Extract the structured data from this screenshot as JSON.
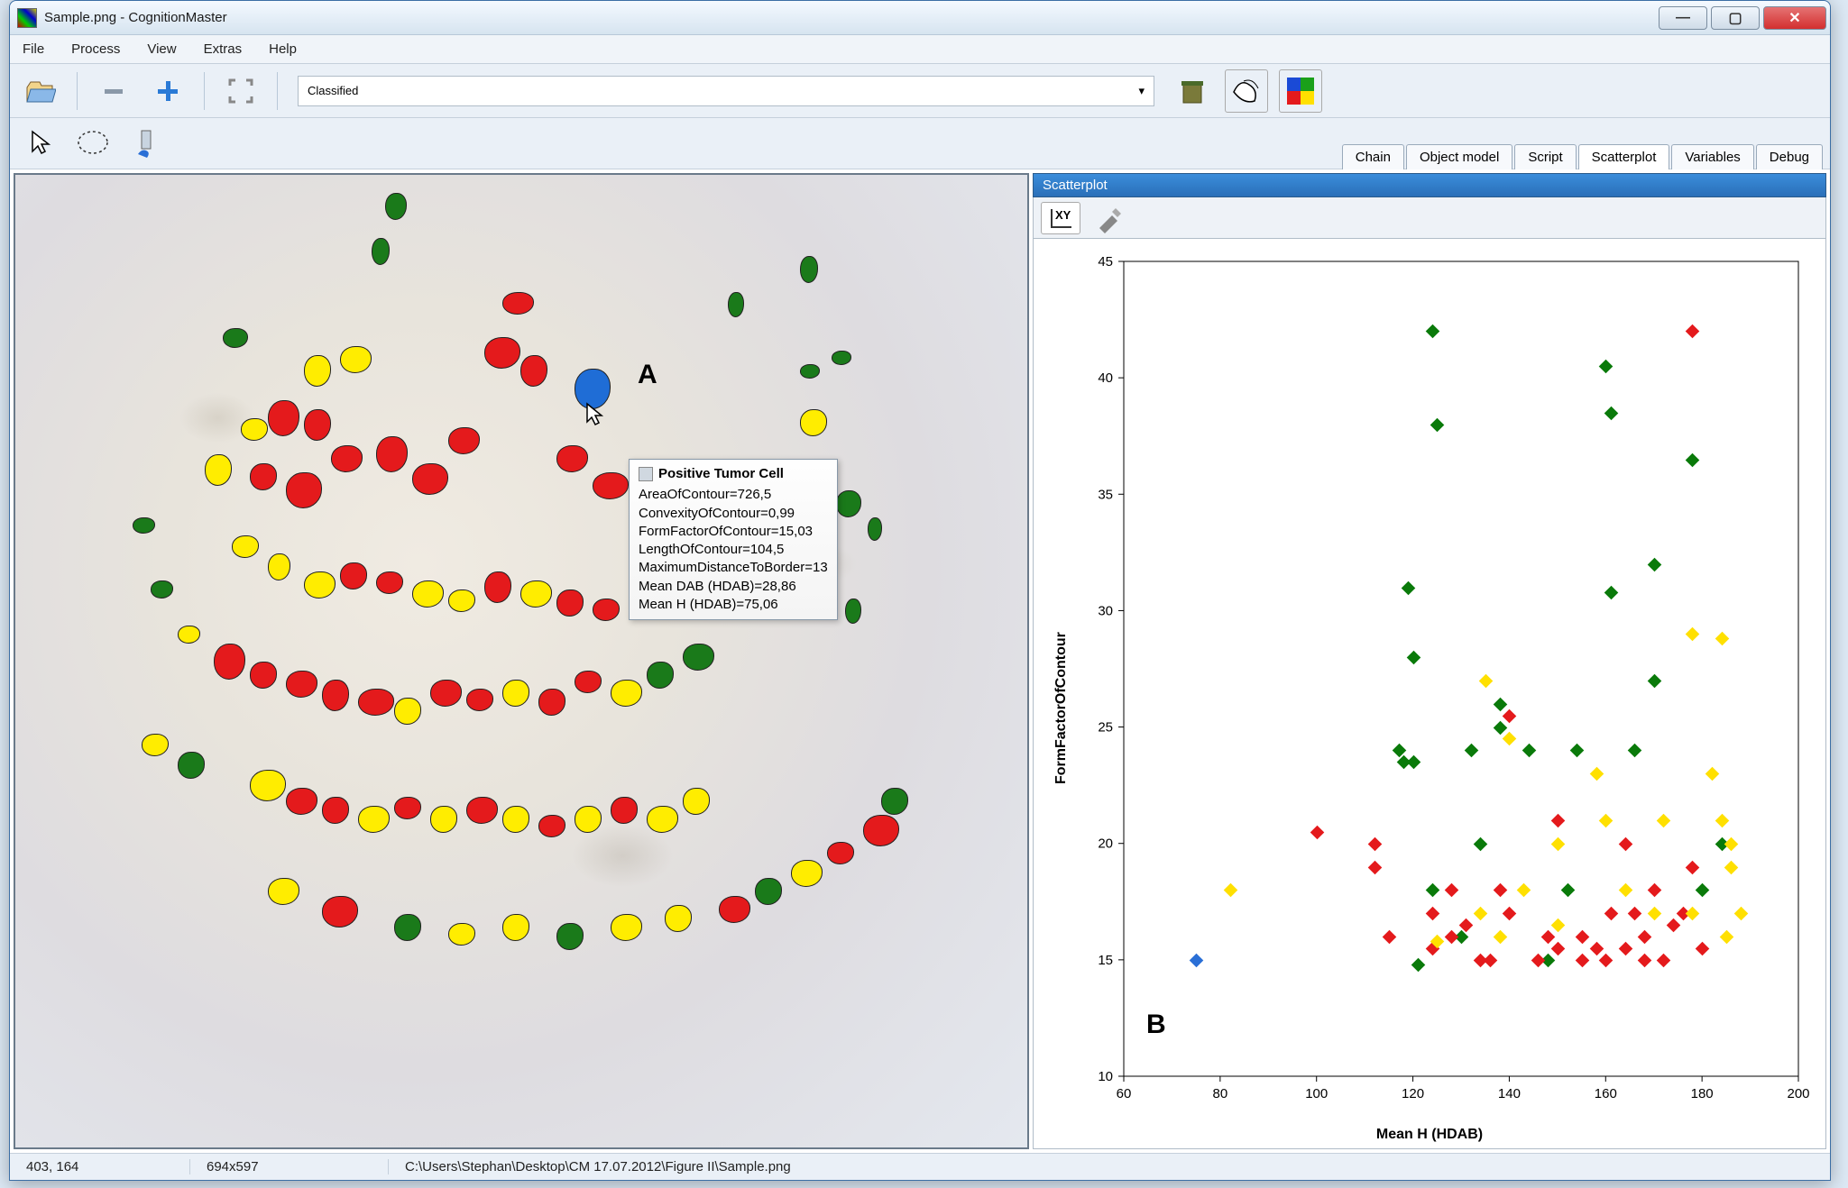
{
  "window": {
    "title": "Sample.png - CognitionMaster"
  },
  "menubar": [
    "File",
    "Process",
    "View",
    "Extras",
    "Help"
  ],
  "toolbar": {
    "dropdown_value": "Classified"
  },
  "tabs": [
    "Chain",
    "Object model",
    "Script",
    "Scatterplot",
    "Variables",
    "Debug"
  ],
  "active_tab": "Scatterplot",
  "panel": {
    "title": "Scatterplot"
  },
  "annotations": {
    "A": "A",
    "B": "B"
  },
  "tooltip": {
    "title": "Positive Tumor Cell",
    "rows": [
      "AreaOfContour=726,5",
      "ConvexityOfContour=0,99",
      "FormFactorOfContour=15,03",
      "LengthOfContour=104,5",
      "MaximumDistanceToBorder=13",
      "Mean DAB (HDAB)=28,86",
      "Mean H (HDAB)=75,06"
    ]
  },
  "statusbar": {
    "coords": "403, 164",
    "dims": "694x597",
    "path": "C:\\Users\\Stephan\\Desktop\\CM 17.07.2012\\Figure II\\Sample.png"
  },
  "chart_data": {
    "type": "scatter",
    "xlabel": "Mean H (HDAB)",
    "ylabel": "FormFactorOfContour",
    "xlim": [
      60,
      200
    ],
    "ylim": [
      10,
      45
    ],
    "xticks": [
      60,
      80,
      100,
      120,
      140,
      160,
      180,
      200
    ],
    "yticks": [
      10,
      15,
      20,
      25,
      30,
      35,
      40,
      45
    ],
    "series": [
      {
        "name": "green",
        "color": "#0a7a0a",
        "points": [
          [
            124,
            42
          ],
          [
            125,
            38
          ],
          [
            119,
            31
          ],
          [
            120,
            28
          ],
          [
            117,
            24
          ],
          [
            118,
            23.5
          ],
          [
            120,
            23.5
          ],
          [
            124,
            18
          ],
          [
            121,
            14.8
          ],
          [
            132,
            24
          ],
          [
            134,
            20
          ],
          [
            130,
            16
          ],
          [
            138,
            25
          ],
          [
            138,
            26
          ],
          [
            144,
            24
          ],
          [
            148,
            15
          ],
          [
            152,
            18
          ],
          [
            154,
            24
          ],
          [
            160,
            40.5
          ],
          [
            161,
            30.8
          ],
          [
            161,
            38.5
          ],
          [
            166,
            24
          ],
          [
            170,
            27
          ],
          [
            170,
            32
          ],
          [
            178,
            36.5
          ],
          [
            184,
            20
          ],
          [
            180,
            18
          ]
        ]
      },
      {
        "name": "red",
        "color": "#e41a1c",
        "points": [
          [
            100,
            20.5
          ],
          [
            112,
            20
          ],
          [
            112,
            19
          ],
          [
            115,
            16
          ],
          [
            124,
            15.5
          ],
          [
            124,
            17
          ],
          [
            128,
            16
          ],
          [
            128,
            18
          ],
          [
            131,
            16.5
          ],
          [
            134,
            15
          ],
          [
            136,
            15
          ],
          [
            138,
            18
          ],
          [
            140,
            17
          ],
          [
            140,
            25.5
          ],
          [
            146,
            15
          ],
          [
            148,
            16
          ],
          [
            150,
            21
          ],
          [
            150,
            15.5
          ],
          [
            155,
            16
          ],
          [
            155,
            15
          ],
          [
            158,
            15.5
          ],
          [
            160,
            15
          ],
          [
            161,
            17
          ],
          [
            164,
            15.5
          ],
          [
            164,
            20
          ],
          [
            166,
            17
          ],
          [
            168,
            15
          ],
          [
            168,
            16
          ],
          [
            170,
            18
          ],
          [
            172,
            15
          ],
          [
            174,
            16.5
          ],
          [
            176,
            17
          ],
          [
            178,
            42
          ],
          [
            178,
            19
          ],
          [
            180,
            15.5
          ]
        ]
      },
      {
        "name": "yellow",
        "color": "#ffe000",
        "points": [
          [
            82,
            18
          ],
          [
            125,
            15.8
          ],
          [
            134,
            17
          ],
          [
            135,
            27
          ],
          [
            138,
            16
          ],
          [
            140,
            24.5
          ],
          [
            143,
            18
          ],
          [
            150,
            20
          ],
          [
            150,
            16.5
          ],
          [
            158,
            23
          ],
          [
            160,
            21
          ],
          [
            164,
            18
          ],
          [
            170,
            17
          ],
          [
            172,
            21
          ],
          [
            178,
            17
          ],
          [
            178,
            29
          ],
          [
            182,
            23
          ],
          [
            184,
            28.8
          ],
          [
            184,
            21
          ],
          [
            185,
            16
          ],
          [
            186,
            19
          ],
          [
            186,
            20
          ],
          [
            188,
            17
          ]
        ]
      },
      {
        "name": "blue",
        "color": "#2a6fd6",
        "points": [
          [
            75,
            15
          ]
        ]
      }
    ]
  }
}
